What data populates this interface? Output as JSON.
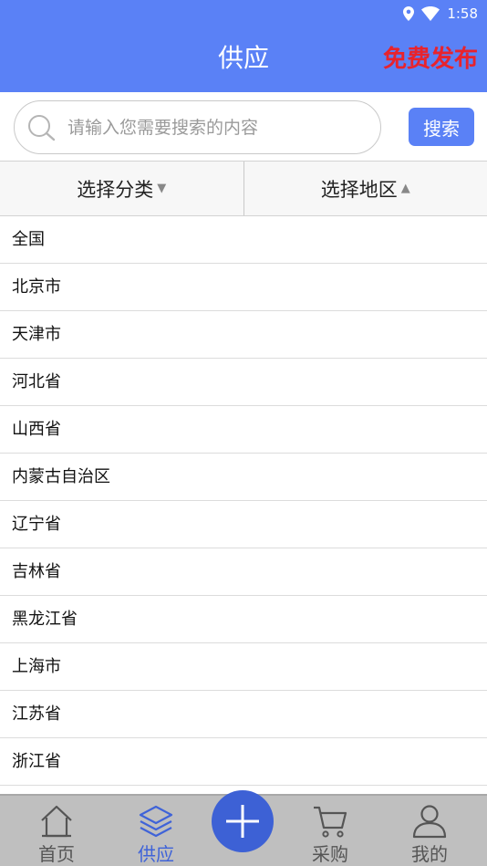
{
  "status": {
    "time": "1:58",
    "icons": [
      "location-icon",
      "wifi-icon"
    ]
  },
  "header": {
    "title": "供应",
    "publish_label": "免费发布"
  },
  "search": {
    "placeholder": "请输入您需要搜索的内容",
    "value": "",
    "button_label": "搜索"
  },
  "filters": {
    "category": "选择分类",
    "region": "选择地区"
  },
  "regions": [
    "全国",
    "北京市",
    "天津市",
    "河北省",
    "山西省",
    "内蒙古自治区",
    "辽宁省",
    "吉林省",
    "黑龙江省",
    "上海市",
    "江苏省",
    "浙江省"
  ],
  "tabbar": {
    "items": [
      {
        "label": "首页",
        "icon": "home-icon"
      },
      {
        "label": "供应",
        "icon": "layers-icon",
        "active": true
      },
      {
        "label": "采购",
        "icon": "cart-icon"
      },
      {
        "label": "我的",
        "icon": "user-icon"
      }
    ],
    "center_icon": "plus-icon"
  },
  "colors": {
    "brand": "#5a81f6",
    "publish": "#e8232d",
    "tab_active": "#3f63d8"
  }
}
